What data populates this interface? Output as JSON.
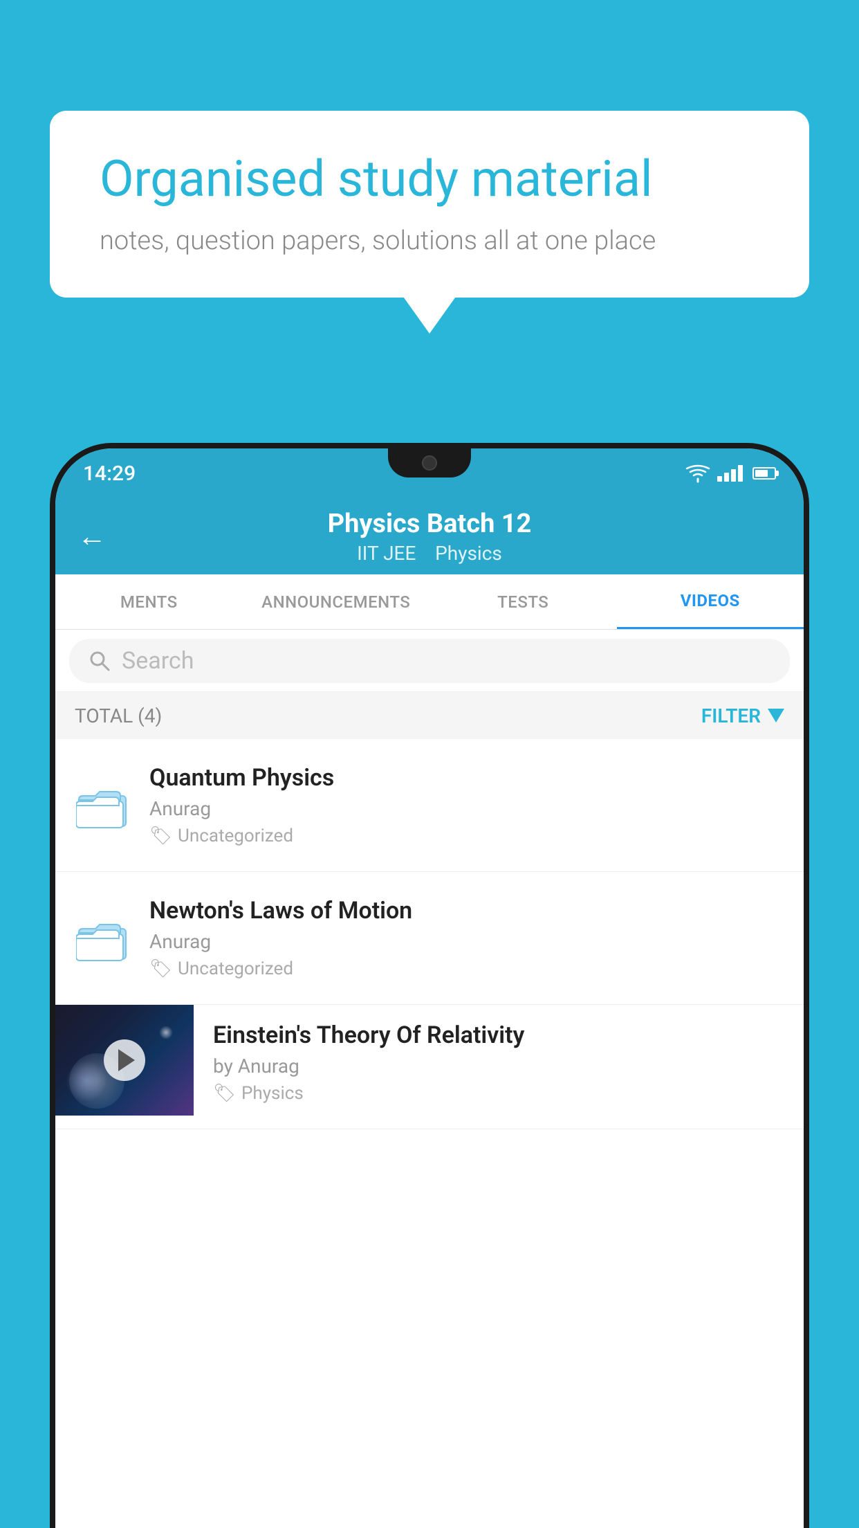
{
  "background_color": "#29b6d8",
  "speech_bubble": {
    "title": "Organised study material",
    "subtitle": "notes, question papers, solutions all at one place"
  },
  "status_bar": {
    "time": "14:29"
  },
  "app_header": {
    "title": "Physics Batch 12",
    "subtitle_parts": [
      "IIT JEE",
      "Physics"
    ],
    "back_label": "←"
  },
  "tabs": [
    {
      "label": "MENTS",
      "active": false
    },
    {
      "label": "ANNOUNCEMENTS",
      "active": false
    },
    {
      "label": "TESTS",
      "active": false
    },
    {
      "label": "VIDEOS",
      "active": true
    }
  ],
  "search": {
    "placeholder": "Search"
  },
  "filter_bar": {
    "total_label": "TOTAL (4)",
    "filter_label": "FILTER"
  },
  "videos": [
    {
      "title": "Quantum Physics",
      "author": "Anurag",
      "tag": "Uncategorized",
      "has_thumb": false
    },
    {
      "title": "Newton's Laws of Motion",
      "author": "Anurag",
      "tag": "Uncategorized",
      "has_thumb": false
    },
    {
      "title": "Einstein's Theory Of Relativity",
      "author": "by Anurag",
      "tag": "Physics",
      "has_thumb": true
    }
  ]
}
